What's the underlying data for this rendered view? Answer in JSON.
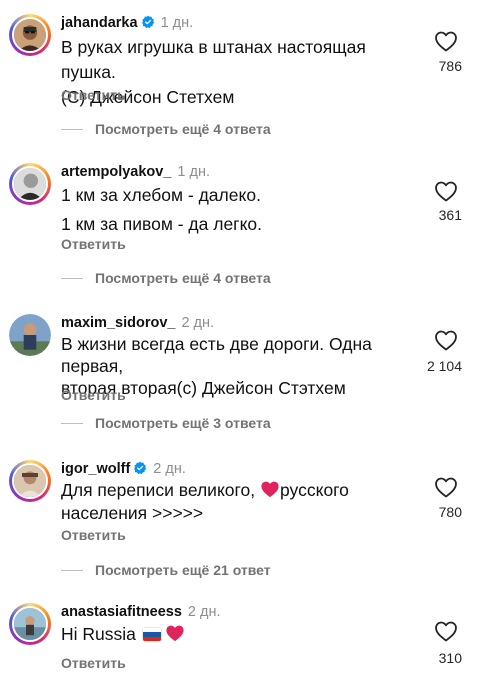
{
  "comments": [
    {
      "username": "jahandarka",
      "verified": true,
      "time": "1 дн.",
      "lines": [
        "В руках игрушка в штанах настоящая пушка.",
        "(С) Джейсон Стетхем"
      ],
      "likes": "786",
      "reply_label": "Ответить",
      "thread_label": "Посмотреть ещё 4 ответа"
    },
    {
      "username": "artempolyakov_",
      "verified": false,
      "time": "1 дн.",
      "lines": [
        "1 км за хлебом - далеко.",
        "1 км за пивом - да легко."
      ],
      "likes": "361",
      "reply_label": "Ответить",
      "thread_label": "Посмотреть ещё 4 ответа"
    },
    {
      "username": "maxim_sidorov_",
      "verified": false,
      "time": "2 дн.",
      "lines": [
        "В жизни всегда есть две дороги. Одна первая,",
        "вторая вторая(с) Джейсон Стэтхем"
      ],
      "likes": "2 104",
      "reply_label": "Ответить",
      "thread_label": "Посмотреть ещё 3 ответа"
    },
    {
      "username": "igor_wolff",
      "verified": true,
      "time": "2 дн.",
      "line1_before": "Для переписи великого, ",
      "emoji": "heart",
      "line1_after": "русского",
      "line2": "населения >>>>>",
      "likes": "780",
      "reply_label": "Ответить",
      "thread_label": "Посмотреть ещё 21 ответ"
    },
    {
      "username": "anastasiafitneess",
      "verified": false,
      "time": "2 дн.",
      "text": "Hi Russia",
      "emojis": [
        "russian-flag",
        "heart"
      ],
      "likes": "310",
      "reply_label": "Ответить"
    }
  ],
  "colors": {
    "meta_gray": "#737373",
    "time_gray": "#8e8e8e",
    "verified_blue": "#0095f6",
    "heart_red": "#e0245e"
  },
  "icons": [
    "like-heart-outline-icon",
    "verified-badge-icon",
    "red-heart-emoji",
    "russian-flag-emoji"
  ]
}
